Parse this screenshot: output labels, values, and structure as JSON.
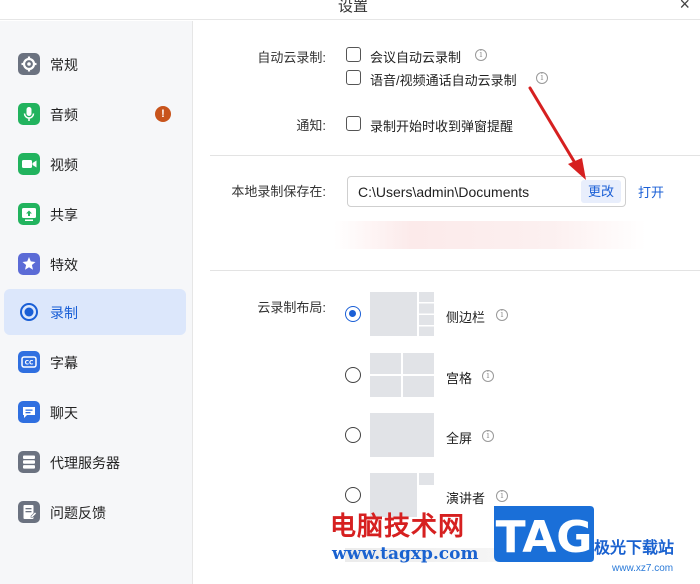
{
  "window": {
    "title": "设置",
    "close": "×"
  },
  "sidebar": {
    "items": [
      {
        "label": "常规",
        "icon": "gear-icon",
        "color": "#6b7280"
      },
      {
        "label": "音频",
        "icon": "microphone-icon",
        "color": "#22b35e",
        "badge": "!"
      },
      {
        "label": "视频",
        "icon": "video-camera-icon",
        "color": "#22b35e"
      },
      {
        "label": "共享",
        "icon": "screen-share-icon",
        "color": "#22b35e"
      },
      {
        "label": "特效",
        "icon": "sparkle-icon",
        "color": "#5b6bd6"
      },
      {
        "label": "录制",
        "icon": "record-icon",
        "color": "#1a5fd6",
        "active": true
      },
      {
        "label": "字幕",
        "icon": "caption-icon",
        "color": "#2f6fe0"
      },
      {
        "label": "聊天",
        "icon": "chat-icon",
        "color": "#2f6fe0"
      },
      {
        "label": "代理服务器",
        "icon": "server-icon",
        "color": "#6b7280"
      },
      {
        "label": "问题反馈",
        "icon": "feedback-icon",
        "color": "#6b7280"
      }
    ]
  },
  "recording": {
    "auto_cloud_label": "自动云录制:",
    "auto_cloud_options": [
      "会议自动云录制",
      "语音/视频通话自动云录制"
    ],
    "notify_label": "通知:",
    "notify_option": "录制开始时收到弹窗提醒",
    "local_save_label": "本地录制保存在:",
    "local_path": "C:\\Users\\admin\\Documents",
    "change_label": "更改",
    "open_label": "打开",
    "layout_label": "云录制布局:",
    "layouts": [
      {
        "label": "侧边栏",
        "selected": true
      },
      {
        "label": "宫格",
        "selected": false
      },
      {
        "label": "全屏",
        "selected": false
      },
      {
        "label": "演讲者",
        "selected": false
      }
    ]
  },
  "watermark": {
    "cn_text": "电脑技术网",
    "url": "www.tagxp.com",
    "tag": "TAG",
    "site": "极光下载站",
    "site_url": "www.xz7.com"
  },
  "colors": {
    "accent": "#1a5fd6",
    "badge": "#c8541c",
    "arrow": "#d62020"
  }
}
